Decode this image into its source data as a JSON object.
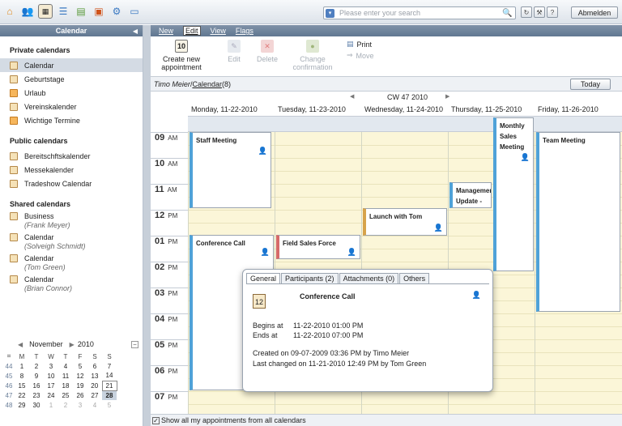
{
  "search": {
    "placeholder": "Please enter your search"
  },
  "top": {
    "logout": "Abmelden",
    "help": "?",
    "refresh": "↻",
    "tools": "⚒"
  },
  "left": {
    "header": "Calendar",
    "private_title": "Private calendars",
    "private": [
      "Calendar",
      "Geburtstage",
      "Urlaub",
      "Vereinskalender",
      "Wichtige Termine"
    ],
    "public_title": "Public calendars",
    "public": [
      "Bereitschftskalender",
      "Messekalender",
      "Tradeshow Calendar"
    ],
    "shared_title": "Shared calendars",
    "shared": [
      {
        "name": "Business",
        "owner": "(Frank Meyer)"
      },
      {
        "name": "Calendar",
        "owner": "(Solveigh Schmidt)"
      },
      {
        "name": "Calendar",
        "owner": "(Tom Green)"
      },
      {
        "name": "Calendar",
        "owner": "(Brian Connor)"
      }
    ]
  },
  "mini": {
    "month": "November",
    "year": "2010",
    "dows": [
      "M",
      "T",
      "W",
      "T",
      "F",
      "S",
      "S"
    ],
    "weeks": [
      {
        "wk": "44",
        "days": [
          "1",
          "2",
          "3",
          "4",
          "5",
          "6",
          "7"
        ]
      },
      {
        "wk": "45",
        "days": [
          "8",
          "9",
          "10",
          "11",
          "12",
          "13",
          "14"
        ]
      },
      {
        "wk": "46",
        "days": [
          "15",
          "16",
          "17",
          "18",
          "19",
          "20",
          "21"
        ]
      },
      {
        "wk": "47",
        "days": [
          "22",
          "23",
          "24",
          "25",
          "26",
          "27",
          "28"
        ]
      },
      {
        "wk": "48",
        "days": [
          "29",
          "30",
          "1",
          "2",
          "3",
          "4",
          "5"
        ]
      }
    ]
  },
  "menu": {
    "new": "New",
    "edit": "Edit",
    "view": "View",
    "flags": "Flags"
  },
  "toolbar": {
    "create": "Create new appointment",
    "create_num": "10",
    "edit": "Edit",
    "delete": "Delete",
    "change": "Change confirmation",
    "print": "Print",
    "move": "Move"
  },
  "crumb": {
    "user": "Timo Meier",
    "sep": " / ",
    "cal": "Calendar",
    "count": " (8)",
    "today": "Today"
  },
  "week": {
    "label": "CW 47 2010"
  },
  "days": [
    "Monday, 11-22-2010",
    "Tuesday, 11-23-2010",
    "Wednesday, 11-24-2010",
    "Thursday, 11-25-2010",
    "Friday, 11-26-2010"
  ],
  "hours": [
    {
      "h": "09",
      "ap": "AM"
    },
    {
      "h": "10",
      "ap": "AM"
    },
    {
      "h": "11",
      "ap": "AM"
    },
    {
      "h": "12",
      "ap": "PM"
    },
    {
      "h": "01",
      "ap": "PM"
    },
    {
      "h": "02",
      "ap": "PM"
    },
    {
      "h": "03",
      "ap": "PM"
    },
    {
      "h": "04",
      "ap": "PM"
    },
    {
      "h": "05",
      "ap": "PM"
    },
    {
      "h": "06",
      "ap": "PM"
    },
    {
      "h": "07",
      "ap": "PM"
    }
  ],
  "appts": {
    "staff": "Staff Meeting",
    "monthly": "Monthly Sales Meeting",
    "team": "Team Meeting",
    "mgmt": "Management Update -",
    "launch": "Launch with Tom",
    "conf": "Conference Call",
    "field": "Field Sales Force"
  },
  "popup": {
    "tabs": [
      "General",
      "Participants (2)",
      "Attachments (0)",
      "Others"
    ],
    "title": "Conference Call",
    "day": "12",
    "begins_k": "Begins at",
    "begins_v": "11-22-2010 01:00 PM",
    "ends_k": "Ends at",
    "ends_v": "11-22-2010 07:00 PM",
    "created": "Created on 09-07-2009 03:36 PM by Timo Meier",
    "changed": "Last changed on 11-21-2010 12:49 PM by Tom Green"
  },
  "bottom": {
    "label": "Show all my appointments from all calendars"
  }
}
